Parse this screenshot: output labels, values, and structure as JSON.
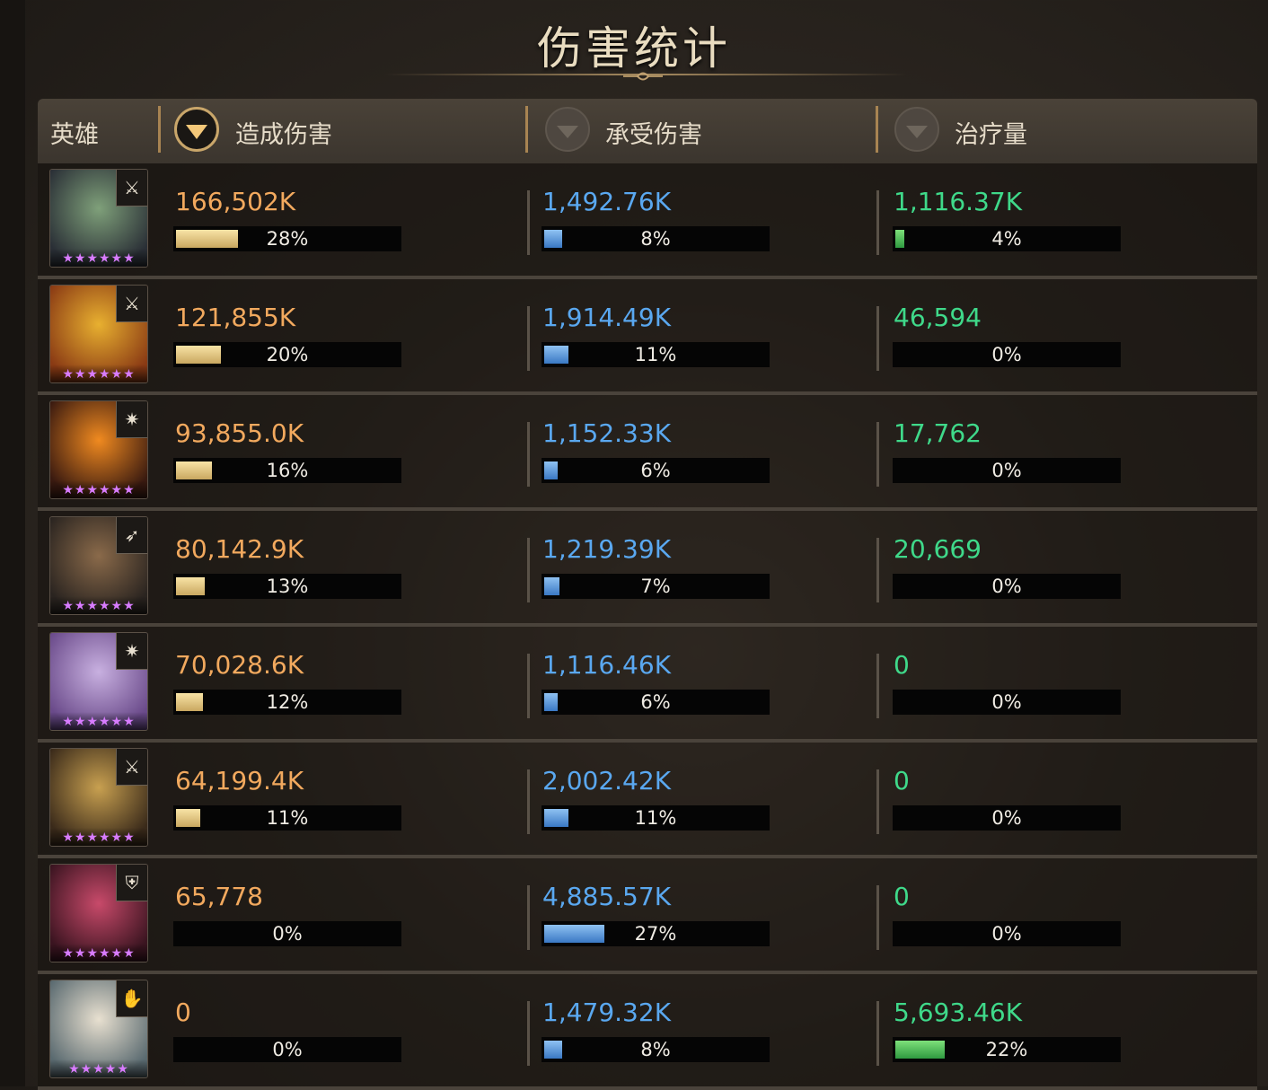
{
  "title": "伤害统计",
  "header": {
    "hero": "英雄",
    "damage_dealt": "造成伤害",
    "damage_taken": "承受伤害",
    "healing": "治疗量",
    "active_sort": "damage_dealt"
  },
  "colors": {
    "damage": "#f2a95e",
    "taken": "#5aa8f0",
    "heal": "#3fd98a",
    "stars": "#d87cff"
  },
  "rows": [
    {
      "hero": {
        "stars": "★★★★★★",
        "role_icon": "sword-icon",
        "role_glyph": "⚔",
        "portrait_colors": [
          "#7fa07a",
          "#2a2f36"
        ]
      },
      "dealt": {
        "value": "166,502K",
        "pct": "28%",
        "fraction": 0.28
      },
      "taken": {
        "value": "1,492.76K",
        "pct": "8%",
        "fraction": 0.08
      },
      "heal": {
        "value": "1,116.37K",
        "pct": "4%",
        "fraction": 0.04
      }
    },
    {
      "hero": {
        "stars": "★★★★★★",
        "role_icon": "sword-icon",
        "role_glyph": "⚔",
        "portrait_colors": [
          "#e8b030",
          "#8a3a14"
        ]
      },
      "dealt": {
        "value": "121,855K",
        "pct": "20%",
        "fraction": 0.2
      },
      "taken": {
        "value": "1,914.49K",
        "pct": "11%",
        "fraction": 0.11
      },
      "heal": {
        "value": "46,594",
        "pct": "0%",
        "fraction": 0
      }
    },
    {
      "hero": {
        "stars": "★★★★★★",
        "role_icon": "magic-icon",
        "role_glyph": "✷",
        "portrait_colors": [
          "#f08a20",
          "#3a1a10"
        ]
      },
      "dealt": {
        "value": "93,855.0K",
        "pct": "16%",
        "fraction": 0.16
      },
      "taken": {
        "value": "1,152.33K",
        "pct": "6%",
        "fraction": 0.06
      },
      "heal": {
        "value": "17,762",
        "pct": "0%",
        "fraction": 0
      }
    },
    {
      "hero": {
        "stars": "★★★★★★",
        "role_icon": "bow-icon",
        "role_glyph": "➶",
        "portrait_colors": [
          "#8a6a4a",
          "#2a2420"
        ]
      },
      "dealt": {
        "value": "80,142.9K",
        "pct": "13%",
        "fraction": 0.13
      },
      "taken": {
        "value": "1,219.39K",
        "pct": "7%",
        "fraction": 0.07
      },
      "heal": {
        "value": "20,669",
        "pct": "0%",
        "fraction": 0
      }
    },
    {
      "hero": {
        "stars": "★★★★★★",
        "role_icon": "magic-icon",
        "role_glyph": "✷",
        "portrait_colors": [
          "#c8b0e0",
          "#6a4a8a"
        ]
      },
      "dealt": {
        "value": "70,028.6K",
        "pct": "12%",
        "fraction": 0.12
      },
      "taken": {
        "value": "1,116.46K",
        "pct": "6%",
        "fraction": 0.06
      },
      "heal": {
        "value": "0",
        "pct": "0%",
        "fraction": 0
      }
    },
    {
      "hero": {
        "stars": "★★★★★★",
        "role_icon": "sword-icon",
        "role_glyph": "⚔",
        "portrait_colors": [
          "#c8a050",
          "#3a2a1a"
        ]
      },
      "dealt": {
        "value": "64,199.4K",
        "pct": "11%",
        "fraction": 0.11
      },
      "taken": {
        "value": "2,002.42K",
        "pct": "11%",
        "fraction": 0.11
      },
      "heal": {
        "value": "0",
        "pct": "0%",
        "fraction": 0
      }
    },
    {
      "hero": {
        "stars": "★★★★★★",
        "role_icon": "shield-icon",
        "role_glyph": "⛨",
        "portrait_colors": [
          "#c84a6a",
          "#3a1420"
        ]
      },
      "dealt": {
        "value": "65,778",
        "pct": "0%",
        "fraction": 0
      },
      "taken": {
        "value": "4,885.57K",
        "pct": "27%",
        "fraction": 0.27
      },
      "heal": {
        "value": "0",
        "pct": "0%",
        "fraction": 0
      }
    },
    {
      "hero": {
        "stars": "★★★★★",
        "role_icon": "healer-icon",
        "role_glyph": "✋",
        "portrait_colors": [
          "#e8e0d0",
          "#5a6a70"
        ]
      },
      "dealt": {
        "value": "0",
        "pct": "0%",
        "fraction": 0
      },
      "taken": {
        "value": "1,479.32K",
        "pct": "8%",
        "fraction": 0.08
      },
      "heal": {
        "value": "5,693.46K",
        "pct": "22%",
        "fraction": 0.22
      }
    }
  ]
}
